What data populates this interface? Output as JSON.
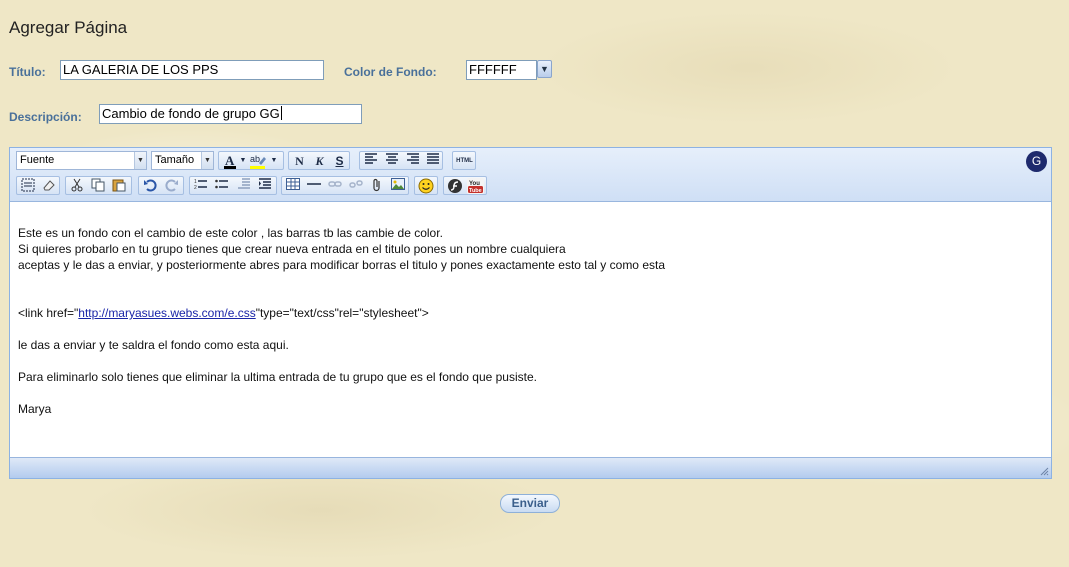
{
  "page": {
    "title": "Agregar Página"
  },
  "form": {
    "titulo_label": "Título:",
    "titulo_value": "LA GALERIA DE LOS PPS",
    "color_label": "Color de Fondo:",
    "color_value": "FFFFFF",
    "descripcion_label": "Descripción:",
    "descripcion_value": "Cambio de fondo de grupo GG"
  },
  "toolbar": {
    "font_select": "Fuente",
    "size_select": "Tamaño",
    "bold_label": "N",
    "italic_label": "K",
    "strike_label": "S",
    "html_label": "HTML",
    "youtube_label_top": "You",
    "youtube_label_bottom": "Tube",
    "highlight_label": "ab",
    "g_badge": "G",
    "colors": {
      "accent": "#49709a",
      "toolbar_bg": "#cfdff5",
      "youtube_red": "#c4302b",
      "font_color_bar": "#000000",
      "highlight_bar": "#ffff00"
    }
  },
  "content": {
    "line1": "Este es un fondo con el cambio de  este color , las barras tb las cambie  de color.",
    "line2": "Si quieres probarlo en tu grupo tienes que crear nueva entrada en el titulo pones un nombre cualquiera",
    "line3": "aceptas y le das a enviar, y posteriormente abres para modificar borras el titulo y pones exactamente esto tal y como esta",
    "link_prefix": "<link href=\"",
    "link_url": "http://maryasues.webs.com/e.css",
    "link_suffix": "\"type=\"text/css\"rel=\"stylesheet\">",
    "line4": "le das a enviar y te saldra el fondo como esta aqui.",
    "line5": "Para eliminarlo solo tienes que eliminar la ultima entrada de tu grupo que es el fondo que pusiste.",
    "signature": "Marya"
  },
  "actions": {
    "send_label": "Enviar"
  }
}
